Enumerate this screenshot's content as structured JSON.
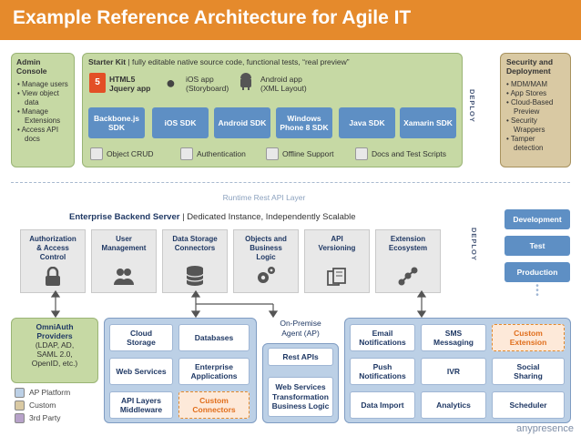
{
  "title": "Example Reference Architecture for Agile IT",
  "admin_console": {
    "heading": "Admin Console",
    "items": [
      "Manage users",
      "View object data",
      "Manage Extensions",
      "Access API docs"
    ]
  },
  "starter_kit": {
    "heading_bold": "Starter Kit",
    "heading_rest": " | fully editable native source code, functional tests, “real preview”",
    "platforms": [
      {
        "name": "HTML5\nJquery app",
        "icon": "html5-icon"
      },
      {
        "name": "iOS app\n(Storyboard)",
        "icon": "apple-icon"
      },
      {
        "name": "Android app\n(XML Layout)",
        "icon": "android-icon"
      }
    ],
    "sdks": [
      "Backbone.js SDK",
      "iOS SDK",
      "Android SDK",
      "Windows Phone 8 SDK",
      "Java SDK",
      "Xamarin SDK"
    ],
    "features": [
      "Object CRUD",
      "Authentication",
      "Offline Support",
      "Docs and Test Scripts"
    ]
  },
  "deploy_label": "DEPLOY",
  "security": {
    "heading": "Security and Deployment",
    "items": [
      "MDM/MAM",
      "App Stores",
      "Cloud-Based Preview",
      "Security Wrappers",
      "Tamper detection"
    ]
  },
  "runtime_label": "Runtime Rest API Layer",
  "backend": {
    "heading_bold": "Enterprise Backend Server",
    "heading_rest": " | Dedicated Instance, Independently Scalable",
    "columns": [
      {
        "label": "Authorization\n& Access\nControl",
        "icon": "lock-icon"
      },
      {
        "label": "User\nManagement",
        "icon": "users-icon"
      },
      {
        "label": "Data Storage\nConnectors",
        "icon": "database-icon"
      },
      {
        "label": "Objects and\nBusiness\nLogic",
        "icon": "gears-icon"
      },
      {
        "label": "API\nVersioning",
        "icon": "versions-icon"
      },
      {
        "label": "Extension\nEcosystem",
        "icon": "network-icon"
      }
    ]
  },
  "stages": [
    "Development",
    "Test",
    "Production"
  ],
  "omniauth": {
    "title": "OmniAuth\nProviders",
    "detail": "(LDAP, AD,\nSAML 2.0,\nOpenID, etc.)"
  },
  "storage_group": [
    "Cloud\nStorage",
    "Databases",
    "Web Services",
    "Enterprise\nApplications",
    "API Layers\nMiddleware",
    "Custom\nConnectors"
  ],
  "on_premise": {
    "title": "On-Premise\nAgent (AP)",
    "items": [
      "Rest APIs",
      "Web Services\nTransformation\nBusiness Logic"
    ]
  },
  "extensions": [
    "Email\nNotifications",
    "SMS\nMessaging",
    "Custom\nExtension",
    "Push\nNotifications",
    "IVR",
    "Social\nSharing",
    "Data Import",
    "Analytics",
    "Scheduler"
  ],
  "legend": [
    {
      "label": "AP Platform",
      "color": "#bcd0e6"
    },
    {
      "label": "Custom",
      "color": "#d9c9a3"
    },
    {
      "label": "3rd Party",
      "color": "#b7a2c9"
    }
  ],
  "brand": "anypresence",
  "colors": {
    "accent": "#e58a2c",
    "blue": "#5e8fc4",
    "green_panel": "#c6d9a4",
    "tan_panel": "#d9c9a3",
    "blue_panel": "#bcd0e6"
  }
}
